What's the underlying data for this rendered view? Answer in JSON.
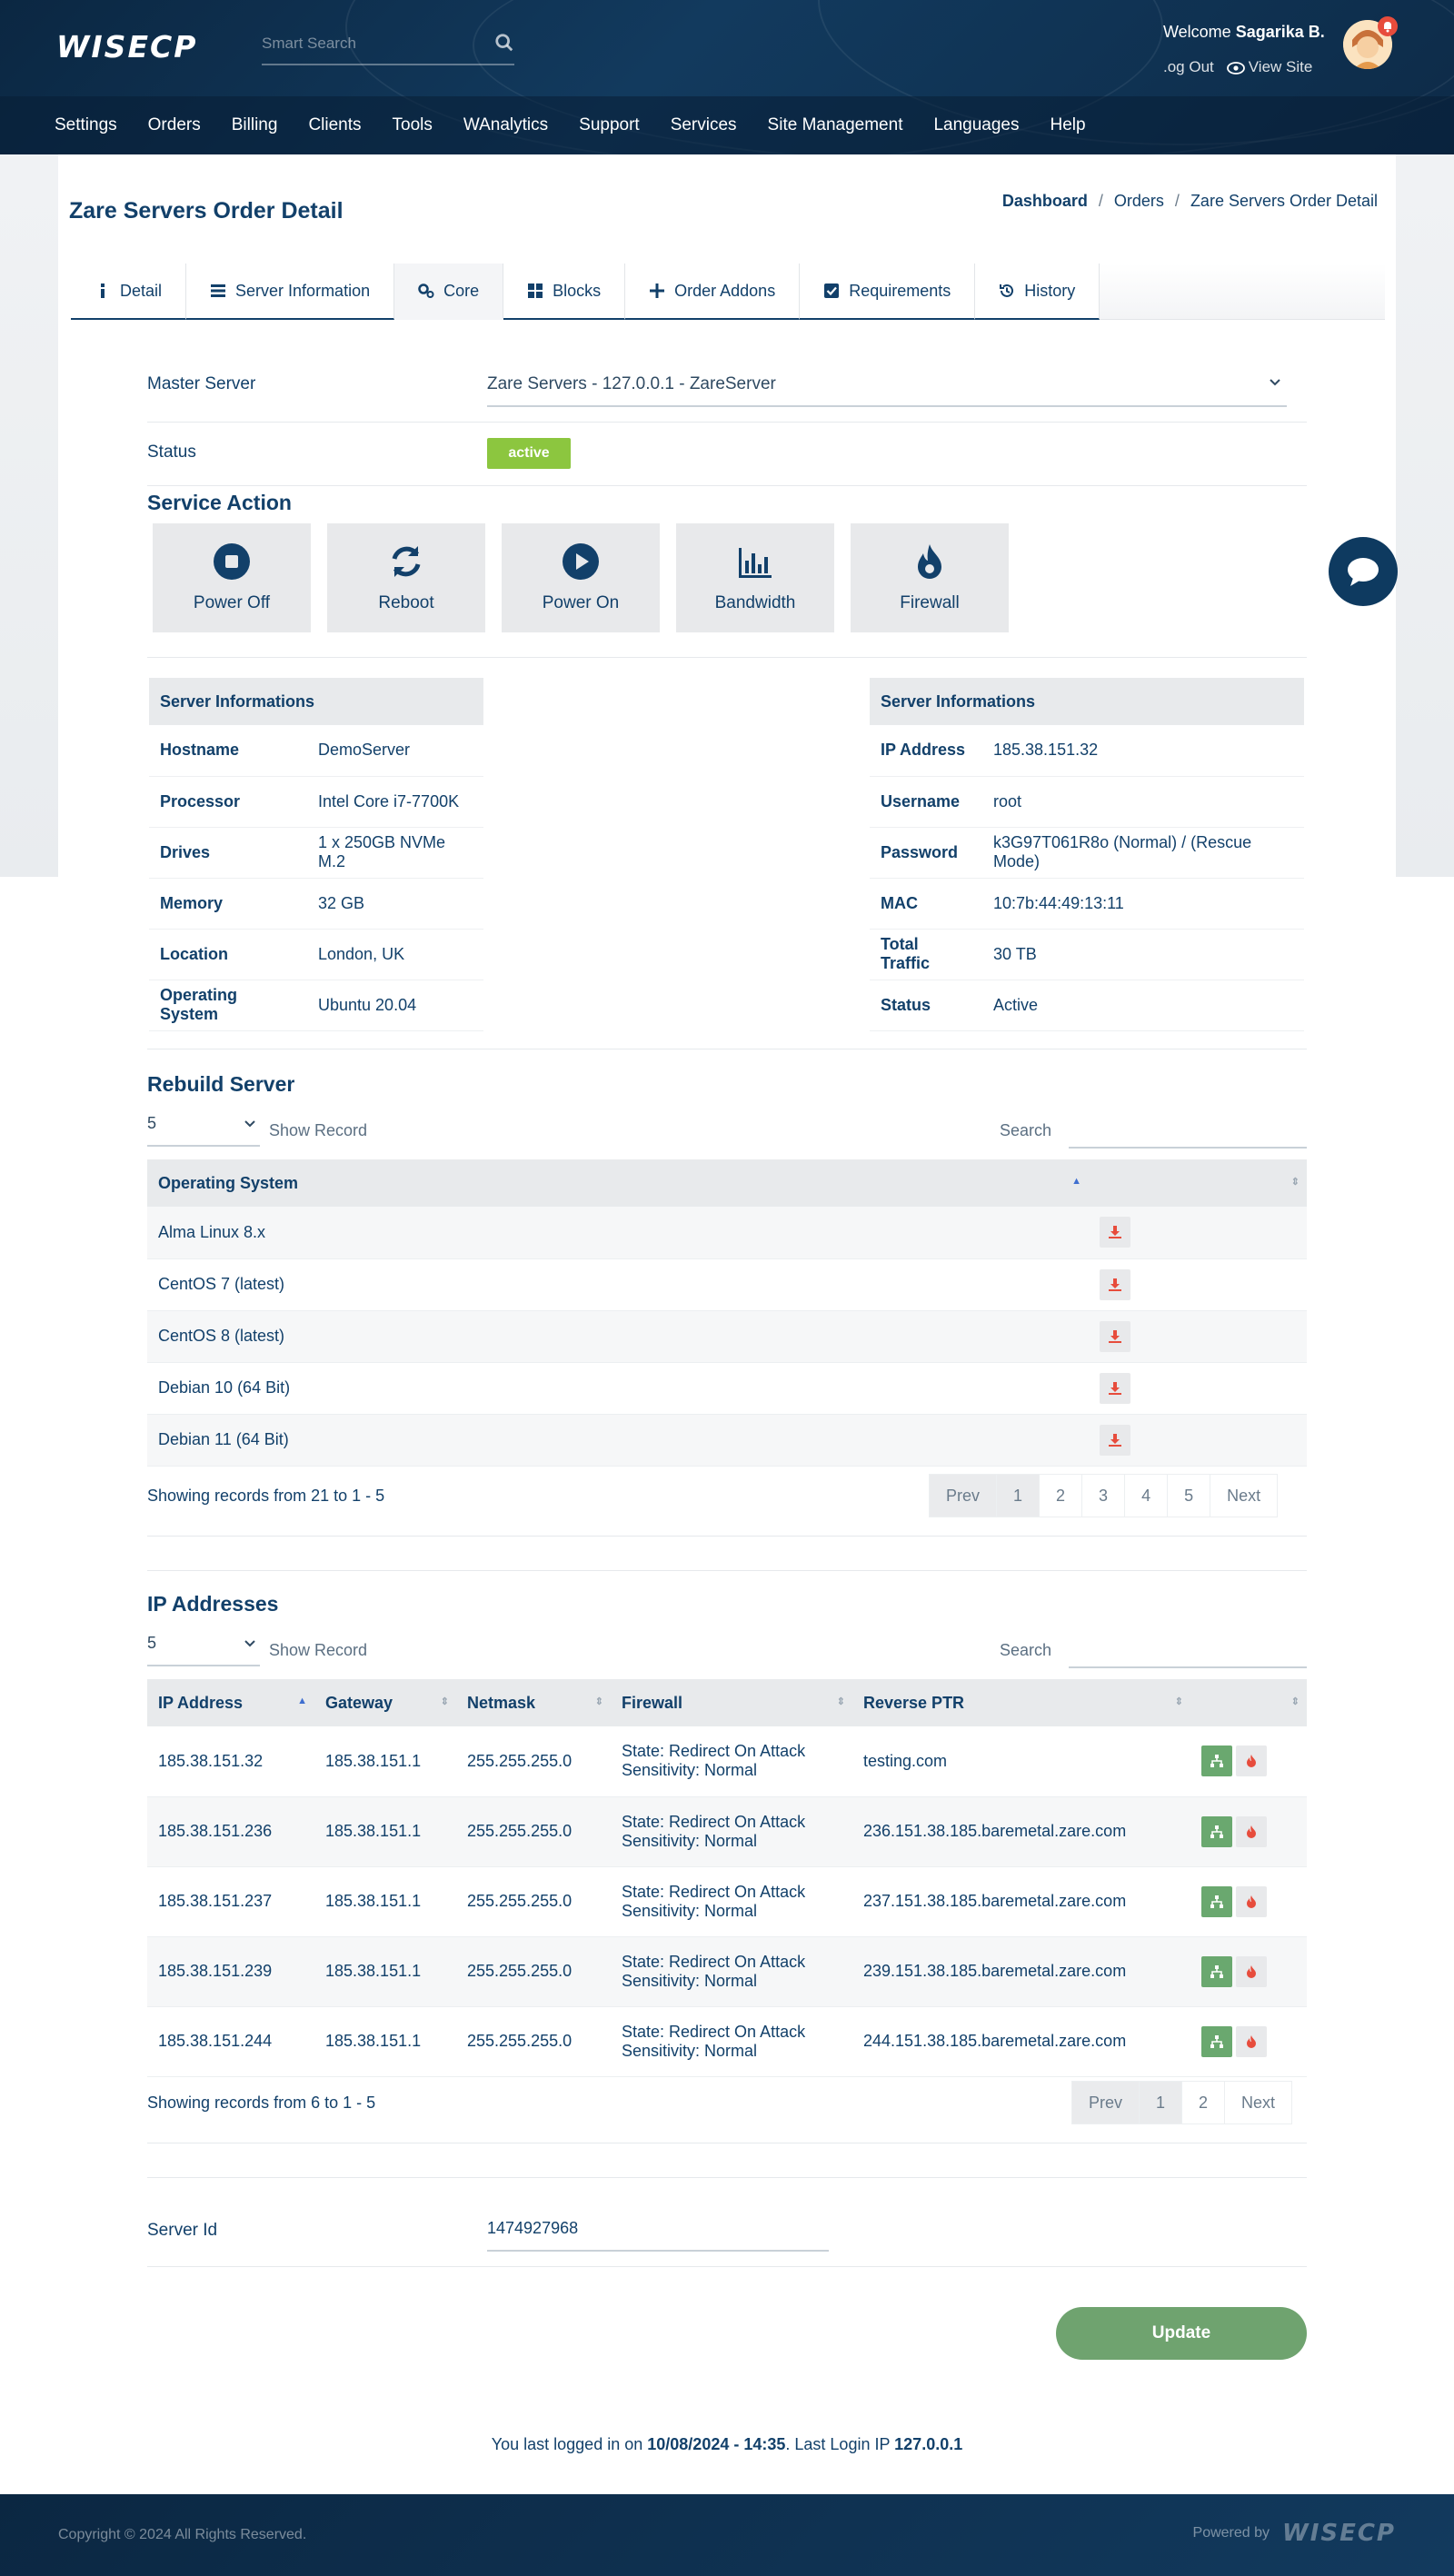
{
  "header": {
    "logo": "WISECP",
    "search_placeholder": "Smart Search",
    "welcome_prefix": "Welcome",
    "user_name": "Sagarika B.",
    "logout": ".og Out",
    "view_site": "View Site"
  },
  "nav": [
    "Settings",
    "Orders",
    "Billing",
    "Clients",
    "Tools",
    "WAnalytics",
    "Support",
    "Services",
    "Site Management",
    "Languages",
    "Help"
  ],
  "page": {
    "title": "Zare Servers Order Detail",
    "breadcrumb": [
      "Dashboard",
      "Orders",
      "Zare Servers Order Detail"
    ]
  },
  "tabs": [
    "Detail",
    "Server Information",
    "Core",
    "Blocks",
    "Order Addons",
    "Requirements",
    "History"
  ],
  "form": {
    "master_server_label": "Master Server",
    "master_server_value": "Zare Servers - 127.0.0.1 - ZareServer",
    "status_label": "Status",
    "status_value": "active",
    "service_action_title": "Service Action",
    "actions": [
      "Power Off",
      "Reboot",
      "Power On",
      "Bandwidth",
      "Firewall"
    ]
  },
  "info_left": {
    "title": "Server Informations",
    "rows": [
      {
        "k": "Hostname",
        "v": "DemoServer"
      },
      {
        "k": "Processor",
        "v": "Intel Core i7-7700K"
      },
      {
        "k": "Drives",
        "v": "1 x 250GB NVMe M.2"
      },
      {
        "k": "Memory",
        "v": "32 GB"
      },
      {
        "k": "Location",
        "v": "London, UK"
      },
      {
        "k": "Operating System",
        "v": "Ubuntu 20.04"
      }
    ]
  },
  "info_right": {
    "title": "Server Informations",
    "rows": [
      {
        "k": "IP Address",
        "v": "185.38.151.32"
      },
      {
        "k": "Username",
        "v": "root"
      },
      {
        "k": "Password",
        "v": "k3G97T061R8o (Normal) / (Rescue Mode)"
      },
      {
        "k": "MAC",
        "v": "10:7b:44:49:13:11"
      },
      {
        "k": "Total Traffic",
        "v": "30 TB"
      },
      {
        "k": "Status",
        "v": "Active"
      }
    ]
  },
  "rebuild": {
    "title": "Rebuild Server",
    "length": "5",
    "show_record": "Show Record",
    "search_label": "Search",
    "column": "Operating System",
    "rows": [
      "Alma Linux 8.x",
      "CentOS 7 (latest)",
      "CentOS 8 (latest)",
      "Debian 10 (64 Bit)",
      "Debian 11 (64 Bit)"
    ],
    "showing": "Showing records from 21 to 1 - 5",
    "pager": [
      "Prev",
      "1",
      "2",
      "3",
      "4",
      "5",
      "Next"
    ]
  },
  "ips": {
    "title": "IP Addresses",
    "length": "5",
    "show_record": "Show Record",
    "search_label": "Search",
    "columns": [
      "IP Address",
      "Gateway",
      "Netmask",
      "Firewall",
      "Reverse PTR"
    ],
    "rows": [
      {
        "ip": "185.38.151.32",
        "gw": "185.38.151.1",
        "mask": "255.255.255.0",
        "fw1": "State: Redirect On Attack",
        "fw2": "Sensitivity: Normal",
        "ptr": "testing.com"
      },
      {
        "ip": "185.38.151.236",
        "gw": "185.38.151.1",
        "mask": "255.255.255.0",
        "fw1": "State: Redirect On Attack",
        "fw2": "Sensitivity: Normal",
        "ptr": "236.151.38.185.baremetal.zare.com"
      },
      {
        "ip": "185.38.151.237",
        "gw": "185.38.151.1",
        "mask": "255.255.255.0",
        "fw1": "State: Redirect On Attack",
        "fw2": "Sensitivity: Normal",
        "ptr": "237.151.38.185.baremetal.zare.com"
      },
      {
        "ip": "185.38.151.239",
        "gw": "185.38.151.1",
        "mask": "255.255.255.0",
        "fw1": "State: Redirect On Attack",
        "fw2": "Sensitivity: Normal",
        "ptr": "239.151.38.185.baremetal.zare.com"
      },
      {
        "ip": "185.38.151.244",
        "gw": "185.38.151.1",
        "mask": "255.255.255.0",
        "fw1": "State: Redirect On Attack",
        "fw2": "Sensitivity: Normal",
        "ptr": "244.151.38.185.baremetal.zare.com"
      }
    ],
    "showing": "Showing records from 6 to 1 - 5",
    "pager": [
      "Prev",
      "1",
      "2",
      "Next"
    ]
  },
  "server_id": {
    "label": "Server Id",
    "value": "1474927968"
  },
  "update_label": "Update",
  "last_login": {
    "prefix": "You last logged in on",
    "date": "10/08/2024 - 14:35",
    "mid": ". Last Login IP",
    "ip": "127.0.0.1"
  },
  "footer": {
    "copyright": "Copyright © 2024 All Rights Reserved.",
    "powered": "Powered by",
    "logo": "WISECP"
  },
  "colors": {
    "navy": "#12406a",
    "header": "#0b2742",
    "active_green": "#8cc63f",
    "update_green": "#6fa36f",
    "danger_red": "#e74c3c"
  }
}
